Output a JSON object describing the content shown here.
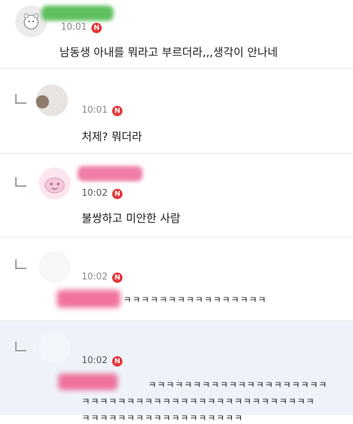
{
  "comments": [
    {
      "time": "10:01",
      "badge": "N",
      "text": "남동생 아내를 뭐라고 부르더라,,,생각이 안나네"
    },
    {
      "time": "10:01",
      "badge": "N",
      "text": "처제? 뭐더라"
    },
    {
      "time": "10:02",
      "badge": "N",
      "text": "불쌍하고 미안한 사람"
    },
    {
      "time": "10:02",
      "badge": "N",
      "text": "ㅋㅋㅋㅋㅋㅋㅋㅋㅋㅋㅋㅋㅋㅋㅋㅋ"
    },
    {
      "time": "10:02",
      "badge": "N",
      "lines": [
        "ㅋㅋㅋㅋㅋㅋㅋㅋㅋㅋㅋㅋㅋㅋㅋㅋㅋㅋㅋㅋ",
        "ㅋㅋㅋㅋㅋㅋㅋㅋㅋㅋㅋㅋㅋㅋㅋㅋㅋㅋㅋㅋㅋㅋㅋㅋㅋㅋ",
        "ㅋㅋㅋㅋㅋㅋㅋㅋㅋㅋㅋㅋㅋㅋㅋㅋㅋㅋ"
      ]
    }
  ]
}
